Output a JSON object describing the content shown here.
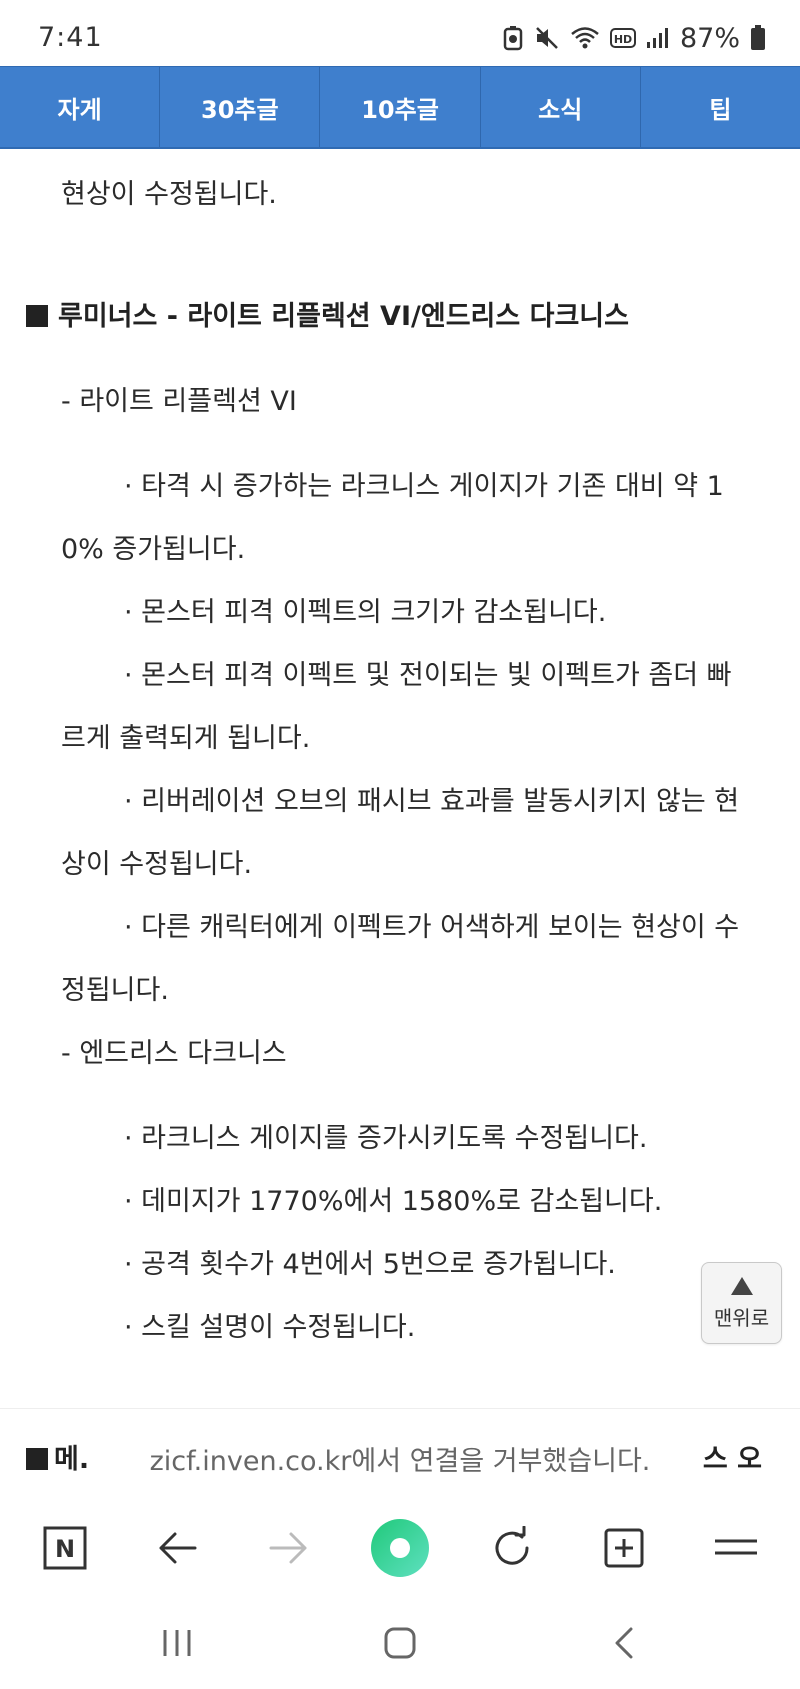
{
  "status_bar": {
    "time": "7:41",
    "battery": "87%",
    "icons": [
      "battery-saver-icon",
      "mute-icon",
      "wifi-icon",
      "hd-voice-icon",
      "signal-icon",
      "battery-icon"
    ]
  },
  "top_tabs": [
    {
      "label": "자게"
    },
    {
      "label": "30추글"
    },
    {
      "label": "10추글"
    },
    {
      "label": "소식"
    },
    {
      "label": "팁"
    }
  ],
  "article": {
    "lines": [
      "현상이 수정됩니다.",
      "루미너스 - 라이트 리플렉션 VI/엔드리스 다크니스",
      "- 라이트 리플렉션 VI",
      "· 타격 시 증가하는 라크니스 게이지가 기존 대비 약 1",
      "0% 증가됩니다.",
      "· 몬스터 피격 이펙트의 크기가 감소됩니다.",
      "· 몬스터 피격 이펙트 및 전이되는 빛 이펙트가 좀더 빠",
      "르게 출력되게 됩니다.",
      "· 리버레이션 오브의 패시브 효과를 발동시키지 않는 현",
      "상이 수정됩니다.",
      "· 다른 캐릭터에게 이펙트가 어색하게 보이는 현상이 수",
      "정됩니다.",
      "- 엔드리스 다크니스",
      "· 라크니스 게이지를 증가시키도록 수정됩니다.",
      "· 데미지가 1770%에서 1580%로 감소됩니다.",
      "· 공격 횟수가 4번에서 5번으로 증가됩니다.",
      "· 스킬 설명이 수정됩니다."
    ]
  },
  "to_top": {
    "label": "맨위로"
  },
  "error_bar": {
    "left_text": "메.",
    "message": "zicf.inven.co.kr에서 연결을 거부했습니다.",
    "right_text": "스 오"
  },
  "browser_toolbar": {
    "buttons": [
      "naver-home-icon",
      "back-arrow-icon",
      "forward-arrow-icon",
      "green-dot-icon",
      "reload-icon",
      "new-tab-icon",
      "menu-icon"
    ],
    "home_letter": "N"
  },
  "colors": {
    "tab_bar": "#3f7fcd",
    "green_button": "#2fd08a"
  }
}
